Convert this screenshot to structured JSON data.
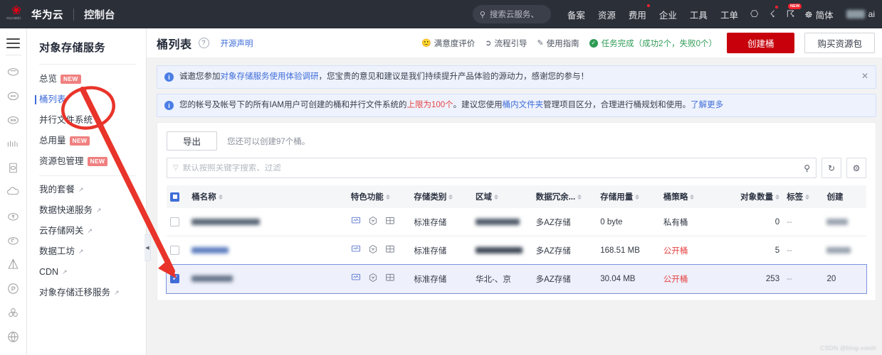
{
  "topbar": {
    "brand": "华为云",
    "console": "控制台",
    "search_placeholder": "搜索云服务、",
    "search_icon": "search-icon",
    "nav": [
      {
        "label": "备案",
        "dot": false
      },
      {
        "label": "资源",
        "dot": false
      },
      {
        "label": "费用",
        "dot": true
      },
      {
        "label": "企业",
        "dot": false
      },
      {
        "label": "工具",
        "dot": false
      },
      {
        "label": "工单",
        "dot": false
      }
    ],
    "icons": [
      {
        "name": "terminal-icon",
        "glyph": "▣",
        "dot": false,
        "badge": ""
      },
      {
        "name": "bell-icon",
        "glyph": "🔔",
        "dot": true,
        "badge": ""
      },
      {
        "name": "help-icon",
        "glyph": "?",
        "dot": false,
        "badge": "NEW"
      }
    ],
    "lang": {
      "icon": "globe-icon",
      "label": "简体"
    },
    "user_ai_label": "ai"
  },
  "rail": {
    "menu_icon": "hamburger-icon",
    "icons": [
      "cloud-obs-icon",
      "cloud-dots-icon",
      "cloud-sfs-icon",
      "wave-icon",
      "doc-cloud-icon",
      "cloud-plain-icon",
      "cloud-upload-icon",
      "cloud-moon-icon",
      "pyramid-icon",
      "p-circle-icon",
      "cluster-icon",
      "globe-w-icon"
    ]
  },
  "service_menu": {
    "title": "对象存储服务",
    "items": [
      {
        "label": "总览",
        "badge": "NEW",
        "active": false,
        "external": false
      },
      {
        "label": "桶列表",
        "badge": "",
        "active": true,
        "external": false
      },
      {
        "label": "并行文件系统",
        "badge": "",
        "active": false,
        "external": false
      },
      {
        "label": "总用量",
        "badge": "NEW",
        "active": false,
        "external": false
      },
      {
        "label": "资源包管理",
        "badge": "NEW",
        "active": false,
        "external": false
      },
      {
        "label": "我的套餐",
        "badge": "",
        "active": false,
        "external": true
      },
      {
        "label": "数据快递服务",
        "badge": "",
        "active": false,
        "external": true
      },
      {
        "label": "云存储网关",
        "badge": "",
        "active": false,
        "external": true
      },
      {
        "label": "数据工坊",
        "badge": "",
        "active": false,
        "external": true
      },
      {
        "label": "CDN",
        "badge": "",
        "active": false,
        "external": true
      },
      {
        "label": "对象存储迁移服务",
        "badge": "",
        "active": false,
        "external": true
      }
    ],
    "collapse_icon": "chevron-left-icon"
  },
  "page_header": {
    "title": "桶列表",
    "help_icon": "question-icon",
    "source_link": "开源声明",
    "satisfaction": {
      "icon": "smile-icon",
      "label": "满意度评价"
    },
    "guide": {
      "icon": "flow-icon",
      "label": "流程引导"
    },
    "manual": {
      "icon": "book-icon",
      "label": "使用指南"
    },
    "task_status": {
      "icon": "check-circle-icon",
      "label": "任务完成（成功2个，失败0个）"
    },
    "create_button": "创建桶",
    "buy_button": "购买资源包"
  },
  "alerts": [
    {
      "icon": "info-icon",
      "pre": "诚邀您参加",
      "link": "对象存储服务使用体验调研",
      "post": "，您宝贵的意见和建议是我们持续提升产品体验的源动力，感谢您的参与！",
      "closable": true,
      "close_icon": "close-icon"
    },
    {
      "icon": "info-icon",
      "pre": "您的帐号及帐号下的所有IAM用户可创建的桶和并行文件系统的",
      "hot": "上限为100个",
      "mid": "。建议您使用",
      "link": "桶内文件夹",
      "post": "管理项目区分，合理进行桶规划和使用。",
      "tail_link": "了解更多",
      "closable": false
    }
  ],
  "toolbar": {
    "export_label": "导出",
    "quota_text": "您还可以创建97个桶。"
  },
  "search": {
    "filter_icon": "filter-icon",
    "placeholder": "默认按照关键字搜索、过滤",
    "value": "",
    "search_icon": "search-icon",
    "refresh_icon": "refresh-icon",
    "settings_icon": "gear-icon"
  },
  "table": {
    "select_all_state": "partial",
    "columns": [
      {
        "label": "桶名称",
        "sortable": true
      },
      {
        "label": "特色功能",
        "sortable": true
      },
      {
        "label": "存储类别",
        "sortable": true
      },
      {
        "label": "区域",
        "sortable": true
      },
      {
        "label": "数据冗余...",
        "sortable": true
      },
      {
        "label": "存储用量",
        "sortable": true
      },
      {
        "label": "桶策略",
        "sortable": true
      },
      {
        "label": "对象数量",
        "sortable": true
      },
      {
        "label": "标签",
        "sortable": true
      },
      {
        "label": "创建",
        "sortable": false
      }
    ],
    "feature_icons": [
      "monitor-icon",
      "snowflake-icon",
      "grid-icon"
    ],
    "rows": [
      {
        "selected": false,
        "name": "",
        "name_redacted": true,
        "storage_class": "标准存储",
        "region": "",
        "region_redacted": true,
        "redundancy": "多AZ存储",
        "usage": "0 byte",
        "policy": "私有桶",
        "policy_public": false,
        "objects": "0",
        "tag": "--",
        "created": "2"
      },
      {
        "selected": false,
        "name": "",
        "name_redacted": true,
        "storage_class": "标准存储",
        "region": "华北-北京",
        "region_redacted": true,
        "redundancy": "多AZ存储",
        "usage": "168.51 MB",
        "policy": "公开桶",
        "policy_public": true,
        "objects": "5",
        "tag": "--",
        "created": "20"
      },
      {
        "selected": true,
        "name": "c       am",
        "name_redacted": true,
        "storage_class": "标准存储",
        "region": "华北-、京",
        "region_redacted": true,
        "redundancy": "多AZ存储",
        "usage": "30.04 MB",
        "policy": "公开桶",
        "policy_public": true,
        "objects": "253",
        "tag": "--",
        "created": "20"
      }
    ]
  },
  "watermark": "CSDN @blog-xiaoh",
  "colors": {
    "brand_red": "#c7000b",
    "link_blue": "#3f6dd8",
    "annotation_red": "#e8342a",
    "success_green": "#2e9b55"
  }
}
